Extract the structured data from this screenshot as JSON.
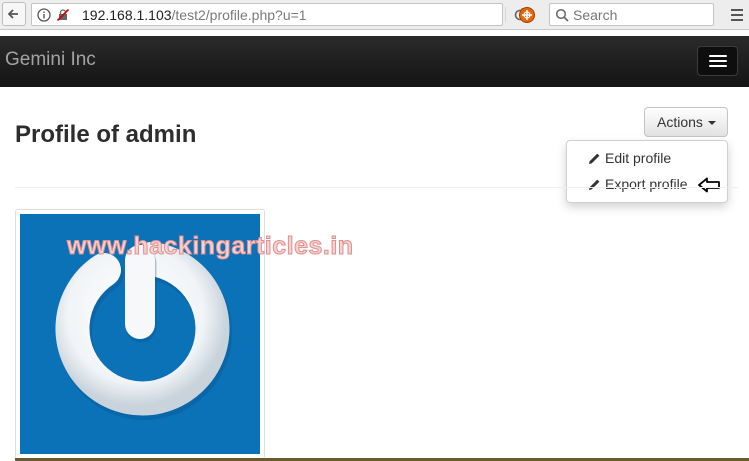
{
  "browser": {
    "url_host": "192.168.1.103",
    "url_path": "/test2/profile.php?u=1",
    "search_placeholder": "Search"
  },
  "navbar": {
    "brand": "Gemini Inc"
  },
  "page": {
    "title": "Profile of admin"
  },
  "actions": {
    "label": "Actions",
    "items": [
      {
        "label": "Edit profile",
        "icon": "pencil-icon"
      },
      {
        "label": "Export profile",
        "icon": "pencil-icon"
      }
    ]
  },
  "avatar": {
    "icon": "power-logo",
    "background": "#0b72b8"
  },
  "watermark": "www.hackingarticles.in",
  "colors": {
    "navbar": "#1b1b1b",
    "brand_text": "#a3a3a3",
    "avatar_bg": "#0b72b8"
  }
}
